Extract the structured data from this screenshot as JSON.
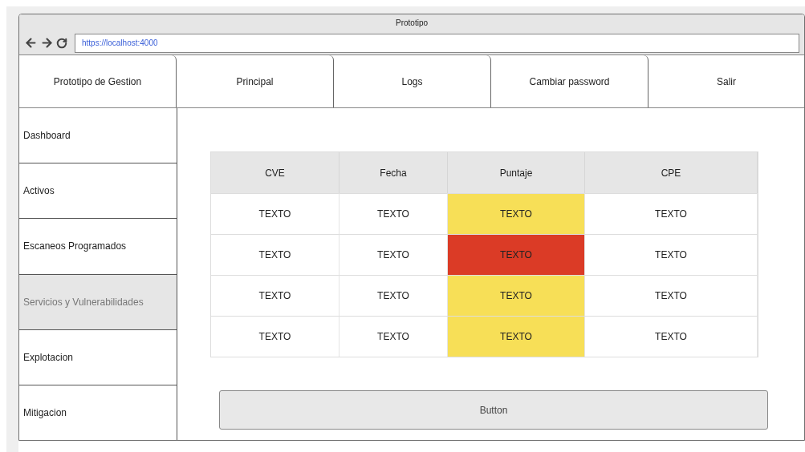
{
  "window": {
    "title": "Prototipo",
    "url": "https://localhost:4000"
  },
  "header": {
    "brand": "Prototipo de Gestion",
    "tabs": [
      "Principal",
      "Logs",
      "Cambiar password",
      "Salir"
    ]
  },
  "sidebar": {
    "items": [
      {
        "label": "Dashboard",
        "selected": false
      },
      {
        "label": "Activos",
        "selected": false
      },
      {
        "label": "Escaneos Programados",
        "selected": false
      },
      {
        "label": "Servicios y Vulnerabilidades",
        "selected": true
      },
      {
        "label": "Explotacion",
        "selected": false
      },
      {
        "label": "Mitigacion",
        "selected": false
      }
    ]
  },
  "table": {
    "columns": [
      "CVE",
      "Fecha",
      "Puntaje",
      "CPE"
    ],
    "rows": [
      {
        "cve": "TEXTO",
        "fecha": "TEXTO",
        "puntaje": "TEXTO",
        "color": "#f7df57",
        "cpe": "TEXTO"
      },
      {
        "cve": "TEXTO",
        "fecha": "TEXTO",
        "puntaje": "TEXTO",
        "color": "#db3b26",
        "cpe": "TEXTO"
      },
      {
        "cve": "TEXTO",
        "fecha": "TEXTO",
        "puntaje": "TEXTO",
        "color": "#f7df57",
        "cpe": "TEXTO"
      },
      {
        "cve": "TEXTO",
        "fecha": "TEXTO",
        "puntaje": "TEXTO",
        "color": "#f7df57",
        "cpe": "TEXTO"
      }
    ]
  },
  "button": "Button"
}
